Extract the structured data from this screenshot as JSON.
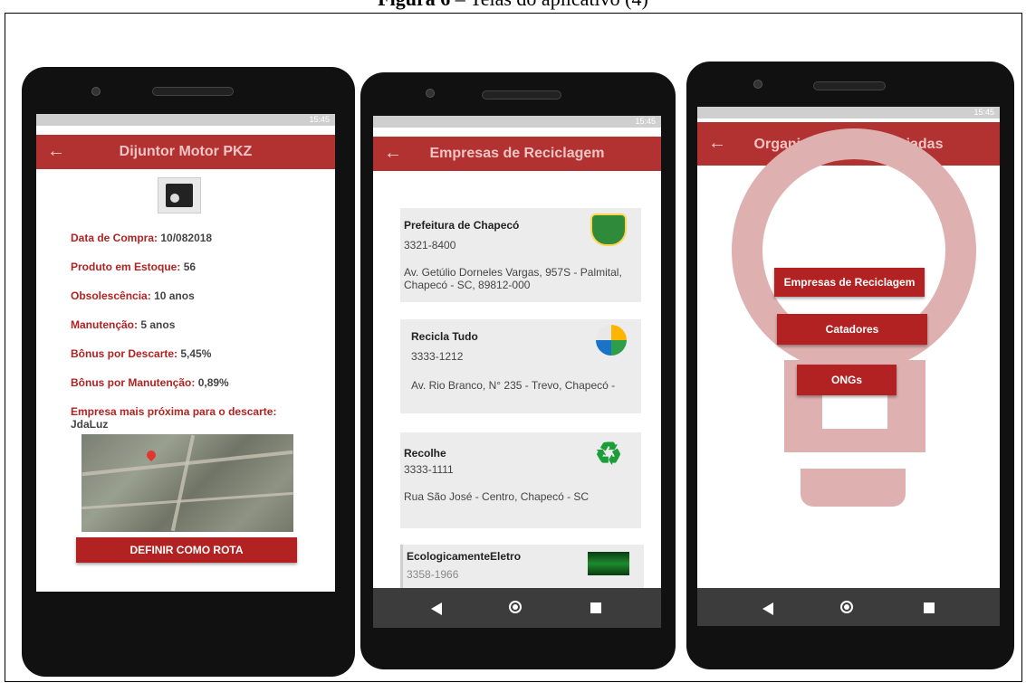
{
  "caption": {
    "label": "Figura 6",
    "text": " – Telas do aplicativo (4)"
  },
  "status_time": "15:45",
  "screen1": {
    "title": "Dijuntor Motor PKZ",
    "fields": [
      {
        "label": "Data de Compra:",
        "value": "10/082018"
      },
      {
        "label": "Produto em Estoque:",
        "value": "56"
      },
      {
        "label": "Obsolescência:",
        "value": "10 anos"
      },
      {
        "label": "Manutenção:",
        "value": "5 anos"
      },
      {
        "label": "Bônus por Descarte:",
        "value": "5,45%"
      },
      {
        "label": "Bônus por Manutenção:",
        "value": "0,89%"
      },
      {
        "label": "Empresa mais próxima para o descarte:",
        "value": "JdaLuz"
      }
    ],
    "route_button": "DEFINIR COMO ROTA"
  },
  "screen2": {
    "title": "Empresas de Reciclagem",
    "companies": [
      {
        "name": "Prefeitura de Chapecó",
        "phone": "3321-8400",
        "address": "Av. Getúlio Dorneles Vargas, 957S - Palmital, Chapecó - SC, 89812-000",
        "logo": "city-crest-icon"
      },
      {
        "name": "Recicla Tudo",
        "phone": "3333-1212",
        "address": "Av. Rio Branco, N° 235 - Trevo, Chapecó -",
        "logo": "leaf-logo-icon"
      },
      {
        "name": "Recolhe",
        "phone": "3333-1111",
        "address": "Rua São José - Centro, Chapecó - SC",
        "logo": "recycle-icon"
      },
      {
        "name": "EcologicamenteEletro",
        "phone": "3358-1966",
        "address": "",
        "logo": "eletro-logo-icon"
      }
    ]
  },
  "screen3": {
    "title": "Organizações Conveniadas",
    "buttons": [
      "Empresas de Reciclagem",
      "Catadores",
      "ONGs"
    ]
  },
  "colors": {
    "primary": "#b22222",
    "bulb": "#deb0b0",
    "navbar": "#3c3c3c"
  }
}
